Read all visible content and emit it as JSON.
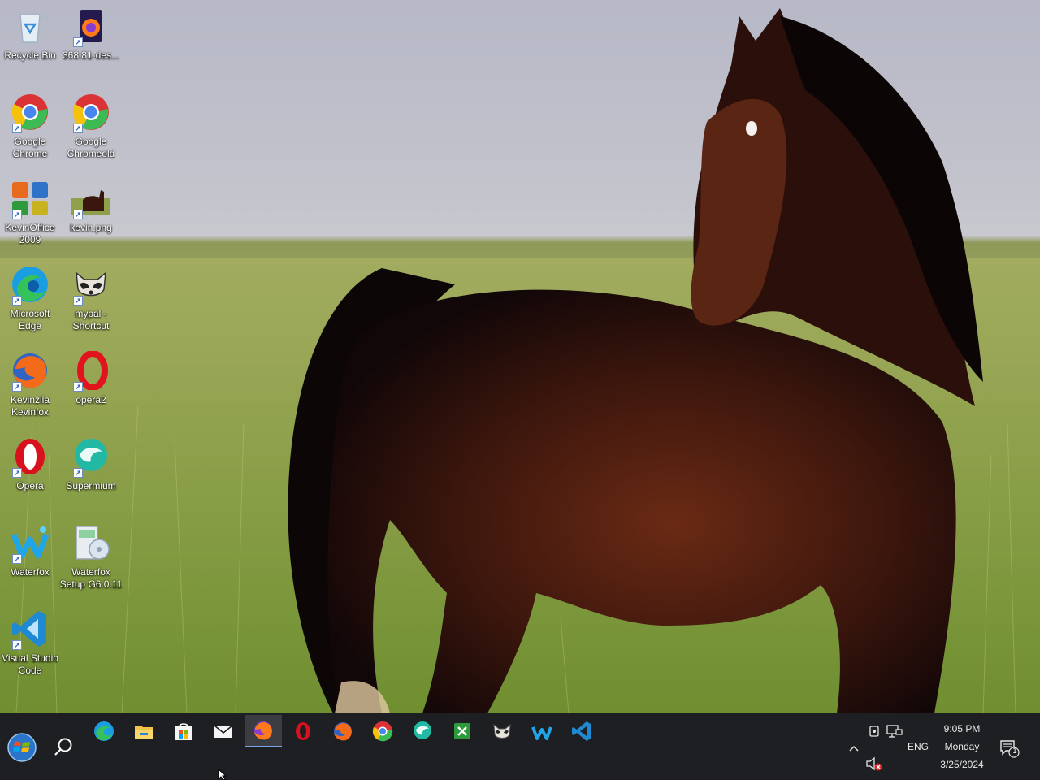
{
  "desktop": {
    "icons": [
      {
        "id": "recycle-bin",
        "label": "Recycle Bin"
      },
      {
        "id": "firefox-installer",
        "label": "368.81-des..."
      },
      {
        "id": "google-chrome",
        "label": "Google Chrome"
      },
      {
        "id": "google-chromeold",
        "label": "Google Chromeold"
      },
      {
        "id": "kevinoffice",
        "label": "KevinOffice 2009"
      },
      {
        "id": "kevin-png",
        "label": "kevin.png"
      },
      {
        "id": "microsoft-edge",
        "label": "Microsoft Edge"
      },
      {
        "id": "mypal",
        "label": "mypal - Shortcut"
      },
      {
        "id": "kevinzila",
        "label": "Kevinzila Kevinfox"
      },
      {
        "id": "opera2",
        "label": "opera2"
      },
      {
        "id": "opera",
        "label": "Opera"
      },
      {
        "id": "supermium",
        "label": "Supermium"
      },
      {
        "id": "waterfox",
        "label": "Waterfox"
      },
      {
        "id": "waterfox-setup",
        "label": "Waterfox Setup G6.0.11"
      },
      {
        "id": "vscode",
        "label": "Visual Studio Code"
      }
    ]
  },
  "taskbar": {
    "pinned": [
      "edge-icon",
      "file-explorer-icon",
      "store-icon",
      "mail-icon",
      "firefox-icon",
      "opera-icon",
      "firefox-icon",
      "chrome-icon",
      "supermium-icon",
      "spreadsheet-icon",
      "mypal-icon",
      "waterfox-icon",
      "vscode-icon"
    ],
    "active_index": 4
  },
  "tray": {
    "language": "ENG",
    "time": "9:05 PM",
    "day": "Monday",
    "date": "3/25/2024",
    "notification_count": "1"
  },
  "colors": {
    "taskbar": "#1d1f23",
    "accent": "#7aa7e6"
  }
}
